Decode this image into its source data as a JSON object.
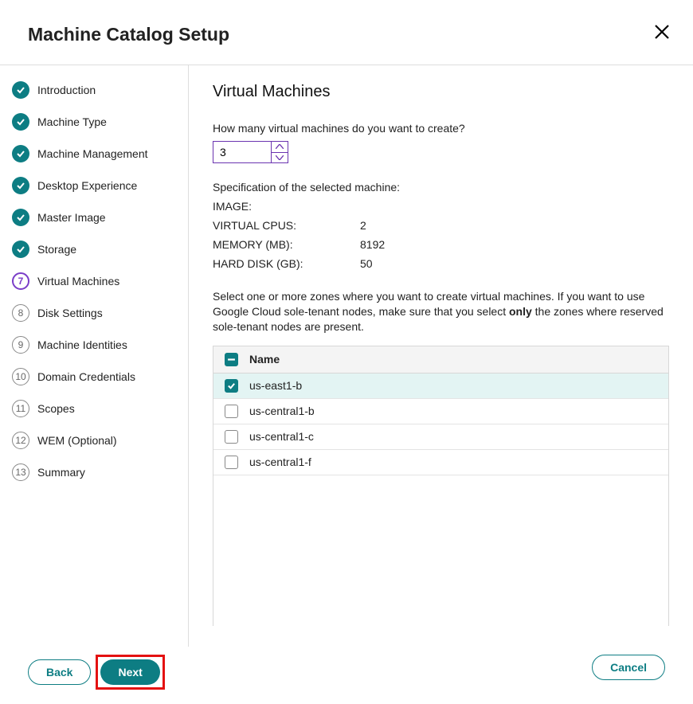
{
  "header": {
    "title": "Machine Catalog Setup"
  },
  "sidebar": {
    "items": [
      {
        "n": "",
        "label": "Introduction",
        "state": "completed"
      },
      {
        "n": "",
        "label": "Machine Type",
        "state": "completed"
      },
      {
        "n": "",
        "label": "Machine Management",
        "state": "completed"
      },
      {
        "n": "",
        "label": "Desktop Experience",
        "state": "completed"
      },
      {
        "n": "",
        "label": "Master Image",
        "state": "completed"
      },
      {
        "n": "",
        "label": "Storage",
        "state": "completed"
      },
      {
        "n": "7",
        "label": "Virtual Machines",
        "state": "current"
      },
      {
        "n": "8",
        "label": "Disk Settings",
        "state": "upcoming"
      },
      {
        "n": "9",
        "label": "Machine Identities",
        "state": "upcoming"
      },
      {
        "n": "10",
        "label": "Domain Credentials",
        "state": "upcoming"
      },
      {
        "n": "11",
        "label": "Scopes",
        "state": "upcoming"
      },
      {
        "n": "12",
        "label": "WEM (Optional)",
        "state": "upcoming"
      },
      {
        "n": "13",
        "label": "Summary",
        "state": "upcoming"
      }
    ]
  },
  "main": {
    "heading": "Virtual Machines",
    "count_question": "How many virtual machines do you want to create?",
    "count_value": "3",
    "spec": {
      "title": "Specification of the selected machine:",
      "rows": [
        {
          "k": "IMAGE:",
          "v": ""
        },
        {
          "k": "VIRTUAL CPUS:",
          "v": "2"
        },
        {
          "k": "MEMORY (MB):",
          "v": "8192"
        },
        {
          "k": "HARD DISK (GB):",
          "v": "50"
        }
      ]
    },
    "zone_note_pre": "Select one or more zones where you want to create virtual machines. If you want to use Google Cloud sole-tenant nodes, make sure that you select ",
    "zone_note_bold": "only",
    "zone_note_post": " the zones where reserved sole-tenant nodes are present.",
    "grid": {
      "col_name": "Name",
      "rows": [
        {
          "name": "us-east1-b",
          "checked": true
        },
        {
          "name": "us-central1-b",
          "checked": false
        },
        {
          "name": "us-central1-c",
          "checked": false
        },
        {
          "name": "us-central1-f",
          "checked": false
        }
      ]
    }
  },
  "footer": {
    "back": "Back",
    "next": "Next",
    "cancel": "Cancel"
  }
}
